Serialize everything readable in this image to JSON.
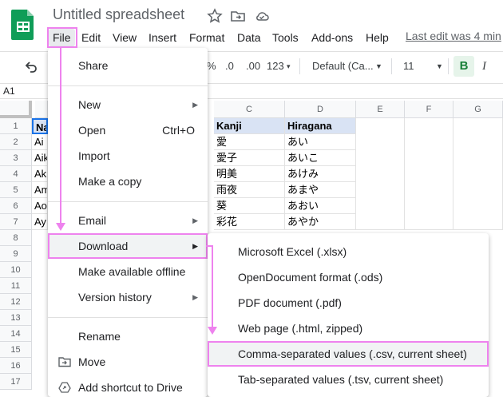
{
  "app": {
    "title": "Untitled spreadsheet",
    "last_edit": "Last edit was 4 min"
  },
  "menubar": [
    "File",
    "Edit",
    "View",
    "Insert",
    "Format",
    "Data",
    "Tools",
    "Add-ons",
    "Help"
  ],
  "toolbar": {
    "percent": "%",
    "dec_decrease": ".0",
    "dec_increase": ".00",
    "more_formats": "123",
    "font": "Default (Ca...",
    "font_size": "11",
    "bold": "B",
    "italic": "I"
  },
  "formula_bar": {
    "cell_ref": "A1"
  },
  "grid": {
    "columns": [
      "C",
      "D",
      "E",
      "F",
      "G"
    ],
    "rows": [
      "1",
      "2",
      "3",
      "4",
      "5",
      "6",
      "7",
      "8",
      "9",
      "10",
      "11",
      "12",
      "13",
      "14",
      "15",
      "16",
      "17"
    ],
    "col_a_partial": [
      "Na",
      "Ai",
      "Aik",
      "Ak",
      "Am",
      "Ao",
      "Ay"
    ],
    "col_c": [
      "Kanji",
      "愛",
      "愛子",
      "明美",
      "雨夜",
      "葵",
      "彩花"
    ],
    "col_d": [
      "Hiragana",
      "あい",
      "あいこ",
      "あけみ",
      "あまや",
      "あおい",
      "あやか"
    ]
  },
  "file_menu": {
    "share": "Share",
    "new": "New",
    "open": "Open",
    "open_shortcut": "Ctrl+O",
    "import": "Import",
    "make_copy": "Make a copy",
    "email": "Email",
    "download": "Download",
    "offline": "Make available offline",
    "version_history": "Version history",
    "rename": "Rename",
    "move": "Move",
    "add_shortcut": "Add shortcut to Drive"
  },
  "download_menu": [
    "Microsoft Excel (.xlsx)",
    "OpenDocument format (.ods)",
    "PDF document (.pdf)",
    "Web page (.html, zipped)",
    "Comma-separated values (.csv, current sheet)",
    "Tab-separated values (.tsv, current sheet)"
  ],
  "colors": {
    "sheets_green": "#0f9d58",
    "highlight": "#ee82ee",
    "header_fill": "#d9e3f4"
  }
}
